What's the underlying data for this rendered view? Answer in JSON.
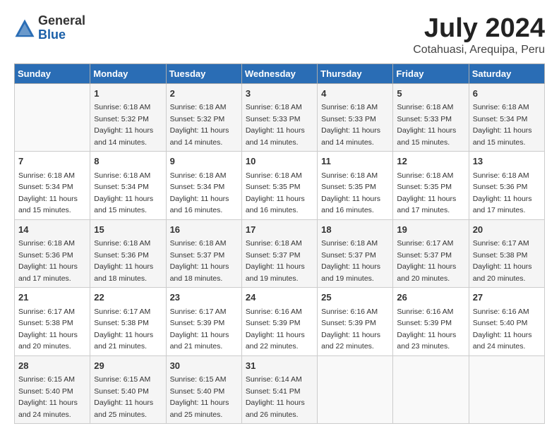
{
  "header": {
    "logo_general": "General",
    "logo_blue": "Blue",
    "month_title": "July 2024",
    "location": "Cotahuasi, Arequipa, Peru"
  },
  "days_of_week": [
    "Sunday",
    "Monday",
    "Tuesday",
    "Wednesday",
    "Thursday",
    "Friday",
    "Saturday"
  ],
  "weeks": [
    [
      {
        "day": "",
        "info": ""
      },
      {
        "day": "1",
        "info": "Sunrise: 6:18 AM\nSunset: 5:32 PM\nDaylight: 11 hours\nand 14 minutes."
      },
      {
        "day": "2",
        "info": "Sunrise: 6:18 AM\nSunset: 5:32 PM\nDaylight: 11 hours\nand 14 minutes."
      },
      {
        "day": "3",
        "info": "Sunrise: 6:18 AM\nSunset: 5:33 PM\nDaylight: 11 hours\nand 14 minutes."
      },
      {
        "day": "4",
        "info": "Sunrise: 6:18 AM\nSunset: 5:33 PM\nDaylight: 11 hours\nand 14 minutes."
      },
      {
        "day": "5",
        "info": "Sunrise: 6:18 AM\nSunset: 5:33 PM\nDaylight: 11 hours\nand 15 minutes."
      },
      {
        "day": "6",
        "info": "Sunrise: 6:18 AM\nSunset: 5:34 PM\nDaylight: 11 hours\nand 15 minutes."
      }
    ],
    [
      {
        "day": "7",
        "info": "Sunrise: 6:18 AM\nSunset: 5:34 PM\nDaylight: 11 hours\nand 15 minutes."
      },
      {
        "day": "8",
        "info": "Sunrise: 6:18 AM\nSunset: 5:34 PM\nDaylight: 11 hours\nand 15 minutes."
      },
      {
        "day": "9",
        "info": "Sunrise: 6:18 AM\nSunset: 5:34 PM\nDaylight: 11 hours\nand 16 minutes."
      },
      {
        "day": "10",
        "info": "Sunrise: 6:18 AM\nSunset: 5:35 PM\nDaylight: 11 hours\nand 16 minutes."
      },
      {
        "day": "11",
        "info": "Sunrise: 6:18 AM\nSunset: 5:35 PM\nDaylight: 11 hours\nand 16 minutes."
      },
      {
        "day": "12",
        "info": "Sunrise: 6:18 AM\nSunset: 5:35 PM\nDaylight: 11 hours\nand 17 minutes."
      },
      {
        "day": "13",
        "info": "Sunrise: 6:18 AM\nSunset: 5:36 PM\nDaylight: 11 hours\nand 17 minutes."
      }
    ],
    [
      {
        "day": "14",
        "info": "Sunrise: 6:18 AM\nSunset: 5:36 PM\nDaylight: 11 hours\nand 17 minutes."
      },
      {
        "day": "15",
        "info": "Sunrise: 6:18 AM\nSunset: 5:36 PM\nDaylight: 11 hours\nand 18 minutes."
      },
      {
        "day": "16",
        "info": "Sunrise: 6:18 AM\nSunset: 5:37 PM\nDaylight: 11 hours\nand 18 minutes."
      },
      {
        "day": "17",
        "info": "Sunrise: 6:18 AM\nSunset: 5:37 PM\nDaylight: 11 hours\nand 19 minutes."
      },
      {
        "day": "18",
        "info": "Sunrise: 6:18 AM\nSunset: 5:37 PM\nDaylight: 11 hours\nand 19 minutes."
      },
      {
        "day": "19",
        "info": "Sunrise: 6:17 AM\nSunset: 5:37 PM\nDaylight: 11 hours\nand 20 minutes."
      },
      {
        "day": "20",
        "info": "Sunrise: 6:17 AM\nSunset: 5:38 PM\nDaylight: 11 hours\nand 20 minutes."
      }
    ],
    [
      {
        "day": "21",
        "info": "Sunrise: 6:17 AM\nSunset: 5:38 PM\nDaylight: 11 hours\nand 20 minutes."
      },
      {
        "day": "22",
        "info": "Sunrise: 6:17 AM\nSunset: 5:38 PM\nDaylight: 11 hours\nand 21 minutes."
      },
      {
        "day": "23",
        "info": "Sunrise: 6:17 AM\nSunset: 5:39 PM\nDaylight: 11 hours\nand 21 minutes."
      },
      {
        "day": "24",
        "info": "Sunrise: 6:16 AM\nSunset: 5:39 PM\nDaylight: 11 hours\nand 22 minutes."
      },
      {
        "day": "25",
        "info": "Sunrise: 6:16 AM\nSunset: 5:39 PM\nDaylight: 11 hours\nand 22 minutes."
      },
      {
        "day": "26",
        "info": "Sunrise: 6:16 AM\nSunset: 5:39 PM\nDaylight: 11 hours\nand 23 minutes."
      },
      {
        "day": "27",
        "info": "Sunrise: 6:16 AM\nSunset: 5:40 PM\nDaylight: 11 hours\nand 24 minutes."
      }
    ],
    [
      {
        "day": "28",
        "info": "Sunrise: 6:15 AM\nSunset: 5:40 PM\nDaylight: 11 hours\nand 24 minutes."
      },
      {
        "day": "29",
        "info": "Sunrise: 6:15 AM\nSunset: 5:40 PM\nDaylight: 11 hours\nand 25 minutes."
      },
      {
        "day": "30",
        "info": "Sunrise: 6:15 AM\nSunset: 5:40 PM\nDaylight: 11 hours\nand 25 minutes."
      },
      {
        "day": "31",
        "info": "Sunrise: 6:14 AM\nSunset: 5:41 PM\nDaylight: 11 hours\nand 26 minutes."
      },
      {
        "day": "",
        "info": ""
      },
      {
        "day": "",
        "info": ""
      },
      {
        "day": "",
        "info": ""
      }
    ]
  ]
}
